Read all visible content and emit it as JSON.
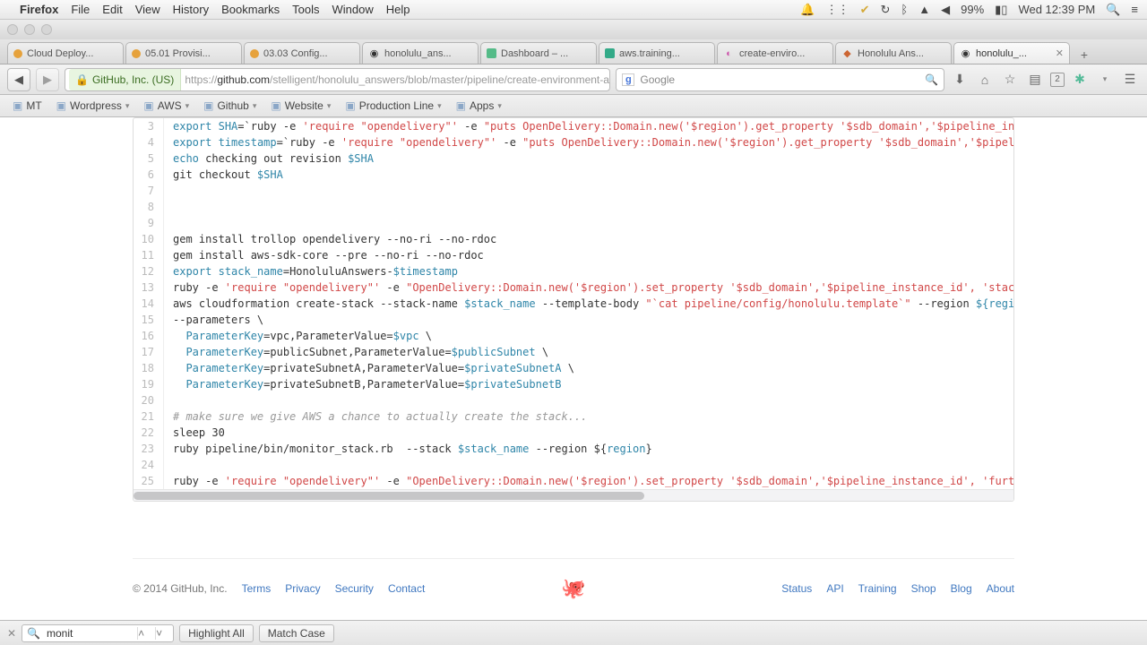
{
  "menubar": {
    "app": "Firefox",
    "items": [
      "File",
      "Edit",
      "View",
      "History",
      "Bookmarks",
      "Tools",
      "Window",
      "Help"
    ]
  },
  "status": {
    "battery": "99%",
    "clock": "Wed 12:39 PM"
  },
  "tabs": [
    {
      "label": "Cloud Deploy...",
      "fav": "dot",
      "color": "#e6a23c"
    },
    {
      "label": "05.01 Provisi...",
      "fav": "dot",
      "color": "#e6a23c"
    },
    {
      "label": "03.03 Config...",
      "fav": "dot",
      "color": "#e6a23c"
    },
    {
      "label": "honolulu_ans...",
      "fav": "gh",
      "color": "#333"
    },
    {
      "label": "Dashboard – ...",
      "fav": "sq",
      "color": "#5b8"
    },
    {
      "label": "aws.training...",
      "fav": "sq",
      "color": "#3a8"
    },
    {
      "label": "create-enviro...",
      "fav": "circ",
      "color": "#c5a"
    },
    {
      "label": "Honolulu Ans...",
      "fav": "diam",
      "color": "#c63"
    },
    {
      "label": "honolulu_...",
      "fav": "gh",
      "color": "#333",
      "active": true
    }
  ],
  "urlbar": {
    "identity": "GitHub, Inc. (US)",
    "proto": "https://",
    "host": "github.com",
    "path": "/stelligent/honolulu_answers/blob/master/pipeline/create-environment-a"
  },
  "search": {
    "placeholder": "Google"
  },
  "bookmarks": [
    "MT",
    "Wordpress",
    "AWS",
    "Github",
    "Website",
    "Production Line",
    "Apps"
  ],
  "code_start_line": 3,
  "code": [
    {
      "t": "h",
      "h": "<span class='fn'>export</span> <span class='var'>SHA</span>=`ruby -e <span class='str'>'require \"opendelivery\"'</span> -e <span class='str'>\"puts OpenDelivery::Domain.new('$region').get_property '$sdb_domain','$pipeline_insta</span>"
    },
    {
      "t": "h",
      "h": "<span class='fn'>export</span> <span class='var'>timestamp</span>=`ruby -e <span class='str'>'require \"opendelivery\"'</span> -e <span class='str'>\"puts OpenDelivery::Domain.new('$region').get_property '$sdb_domain','$pipeline</span>"
    },
    {
      "t": "h",
      "h": "<span class='fn'>echo</span> checking out revision <span class='var'>$SHA</span>"
    },
    {
      "t": "h",
      "h": "git checkout <span class='var'>$SHA</span>"
    },
    {
      "t": "p",
      "p": ""
    },
    {
      "t": "p",
      "p": ""
    },
    {
      "t": "p",
      "p": ""
    },
    {
      "t": "p",
      "p": "gem install trollop opendelivery --no-ri --no-rdoc"
    },
    {
      "t": "p",
      "p": "gem install aws-sdk-core --pre --no-ri --no-rdoc"
    },
    {
      "t": "h",
      "h": "<span class='fn'>export</span> <span class='var'>stack_name</span>=HonoluluAnswers-<span class='var'>$timestamp</span>"
    },
    {
      "t": "h",
      "h": "ruby -e <span class='str'>'require \"opendelivery\"'</span> -e <span class='str'>\"OpenDelivery::Domain.new('$region').set_property '$sdb_domain','$pipeline_instance_id', 'stack_n</span>"
    },
    {
      "t": "h",
      "h": "aws cloudformation create-stack --stack-name <span class='var'>$stack_name</span> --template-body <span class='str'>\"`cat pipeline/config/honolulu.template`\"</span> --region <span class='var'>${</span><span class='var'>region</span><span class='var'>}</span>"
    },
    {
      "t": "p",
      "p": "--parameters \\"
    },
    {
      "t": "h",
      "h": "  <span class='var'>ParameterKey</span>=vpc,ParameterValue=<span class='var'>$vpc</span> \\"
    },
    {
      "t": "h",
      "h": "  <span class='var'>ParameterKey</span>=publicSubnet,ParameterValue=<span class='var'>$publicSubnet</span> \\"
    },
    {
      "t": "h",
      "h": "  <span class='var'>ParameterKey</span>=privateSubnetA,ParameterValue=<span class='var'>$privateSubnetA</span> \\"
    },
    {
      "t": "h",
      "h": "  <span class='var'>ParameterKey</span>=privateSubnetB,ParameterValue=<span class='var'>$privateSubnetB</span>"
    },
    {
      "t": "p",
      "p": ""
    },
    {
      "t": "h",
      "h": "<span class='cmt'># make sure we give AWS a chance to actually create the stack...</span>"
    },
    {
      "t": "p",
      "p": "sleep 30"
    },
    {
      "t": "h",
      "h": "ruby pipeline/bin/monitor_stack.rb  --stack <span class='var'>$stack_name</span> --region ${<span class='var'>region</span>}"
    },
    {
      "t": "p",
      "p": ""
    },
    {
      "t": "h",
      "h": "ruby -e <span class='str'>'require \"opendelivery\"'</span> -e <span class='str'>\"OpenDelivery::Domain.new('$region').set_property '$sdb_domain','$pipeline_instance_id', 'furthes</span>"
    }
  ],
  "footer": {
    "copyright": "© 2014 GitHub, Inc.",
    "left": [
      "Terms",
      "Privacy",
      "Security",
      "Contact"
    ],
    "right": [
      "Status",
      "API",
      "Training",
      "Shop",
      "Blog",
      "About"
    ]
  },
  "find": {
    "query": "monit",
    "highlight": "Highlight All",
    "matchcase": "Match Case"
  }
}
